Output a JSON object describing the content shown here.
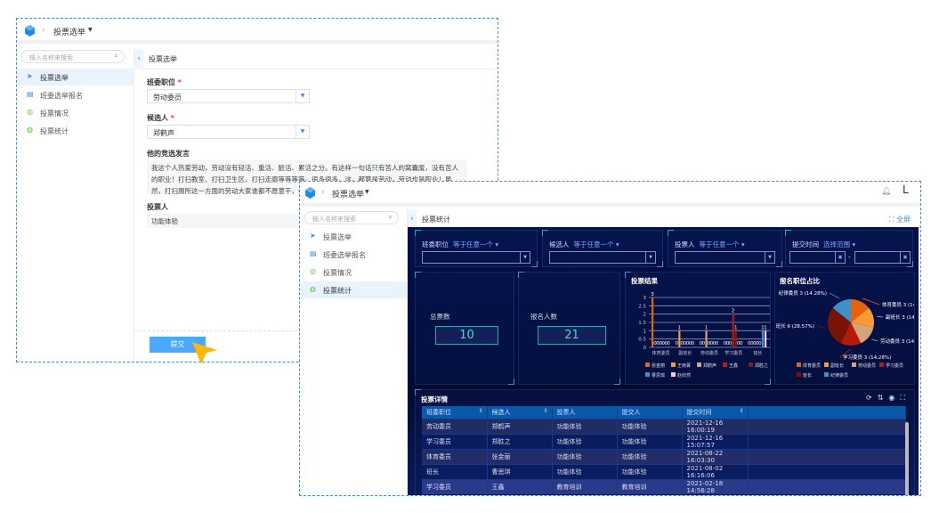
{
  "window1": {
    "breadcrumb": "投票选举",
    "search_placeholder": "输入名称来搜索",
    "sidebar": [
      {
        "label": "投票选举",
        "icon": "send-icon",
        "active": true
      },
      {
        "label": "班委选举报名",
        "icon": "document-icon"
      },
      {
        "label": "投票情况",
        "icon": "target-icon"
      },
      {
        "label": "投票统计",
        "icon": "chart-icon"
      }
    ],
    "page_title": "投票选举",
    "position_label": "班委职位",
    "position_value": "劳动委员",
    "candidate_label": "候选人",
    "candidate_value": "郑鹤声",
    "speech_label": "他的竞选发言",
    "speech_text": "我这个人热爱劳动，劳动没有轻活、重活、脏活、累活之分。有这样一句话只有苦人的窝囊废，没有苦人的职业！打扫教室、打扫卫生区、打扫走廊等等等等，很多很多，这，都算是劳动，劳动也是职业！虽然，打扫厕所这一方面的劳动大家谁都不愿意干，但是，这是光荣的！",
    "voter_label": "投票人",
    "voter_value": "功能体验",
    "submit_label": "提交",
    "required_mark": "*"
  },
  "window2": {
    "breadcrumb": "投票选举",
    "search_placeholder": "输入名称来搜索",
    "sidebar": [
      {
        "label": "投票选举",
        "icon": "send-icon"
      },
      {
        "label": "班委选举报名",
        "icon": "document-icon"
      },
      {
        "label": "投票情况",
        "icon": "target-icon"
      },
      {
        "label": "投票统计",
        "icon": "chart-icon",
        "active": true
      }
    ],
    "page_title": "投票统计",
    "fullscreen_label": "全屏",
    "filters": [
      {
        "label": "班委职位",
        "op": "等于任意一个"
      },
      {
        "label": "候选人",
        "op": "等于任意一个"
      },
      {
        "label": "投票人",
        "op": "等于任意一个"
      },
      {
        "label": "提交时间",
        "op": "选择范围"
      }
    ],
    "range_sep": "-",
    "stats": [
      {
        "label": "总票数",
        "value": "10"
      },
      {
        "label": "报名人数",
        "value": "21"
      }
    ],
    "table": {
      "title": "投票详情",
      "columns": [
        "班委职位",
        "候选人",
        "投票人",
        "提交人",
        "提交时间"
      ],
      "rows": [
        [
          "劳动委员",
          "郑鹤声",
          "功能体验",
          "功能体验",
          "2021-12-16 16:00:19"
        ],
        [
          "学习委员",
          "郑胜之",
          "功能体验",
          "功能体验",
          "2021-12-16 15:07:57"
        ],
        [
          "体育委员",
          "张金丽",
          "功能体验",
          "功能体验",
          "2021-08-22 16:03:30"
        ],
        [
          "班长",
          "曹思琪",
          "功能体验",
          "功能体验",
          "2021-08-02 16:16:06"
        ],
        [
          "学习委员",
          "王鑫",
          "教育培训",
          "教育培训",
          "2021-02-18 14:56:28"
        ]
      ],
      "tool_icons": [
        "refresh-icon",
        "sort-icon",
        "eye-icon",
        "fullscreen-icon"
      ]
    }
  },
  "chart_data": [
    {
      "type": "bar",
      "title": "投票结果",
      "categories": [
        "体育委员",
        "副班长",
        "劳动委员",
        "学习委员",
        "班长"
      ],
      "ylim": [
        0,
        3
      ],
      "yticks": [
        "0",
        "0.5",
        "1",
        "1.5",
        "2",
        "2.5",
        "3"
      ],
      "grid": true,
      "legend": "bottom",
      "series": [
        {
          "name": "张金丽",
          "color": "#e8620c",
          "values": [
            3,
            0,
            0,
            0,
            0
          ]
        },
        {
          "name": "王雨菁",
          "color": "#f59a35",
          "values": [
            0,
            1,
            0,
            0,
            0
          ]
        },
        {
          "name": "郑鹤声",
          "color": "#d3a67a",
          "values": [
            0,
            0,
            1,
            0,
            0
          ]
        },
        {
          "name": "王鑫",
          "color": "#c0180a",
          "values": [
            0,
            0,
            0,
            2,
            0
          ]
        },
        {
          "name": "郑胜之",
          "color": "#8a1a0a",
          "values": [
            0,
            0,
            0,
            1,
            0
          ]
        },
        {
          "name": "曹思琪",
          "color": "#3e90c8",
          "values": [
            0,
            0,
            0,
            0,
            1
          ]
        },
        {
          "name": "赵欣然",
          "color": "#f8c8d8",
          "values": [
            0,
            0,
            0,
            0,
            1
          ]
        }
      ]
    },
    {
      "type": "pie",
      "title": "报名职位占比",
      "legend": "bottom",
      "slices": [
        {
          "name": "体育委员",
          "value": 3,
          "label": "体育委员 3 (14.29%)",
          "color": "#e8620c"
        },
        {
          "name": "副班长",
          "value": 3,
          "label": "副班长 3 (14.29%)",
          "color": "#f59a35"
        },
        {
          "name": "劳动委员",
          "value": 3,
          "label": "劳动委员 3 (14.29%)",
          "color": "#d3a67a"
        },
        {
          "name": "学习委员",
          "value": 3,
          "label": "学习委员 3 (14.28%)",
          "color": "#b81a08"
        },
        {
          "name": "班长",
          "value": 6,
          "label": "班长 6 (28.57%)",
          "color": "#7a1305"
        },
        {
          "name": "纪律委员",
          "value": 3,
          "label": "纪律委员 3 (14.28%)",
          "color": "#3e90c8"
        }
      ]
    }
  ]
}
